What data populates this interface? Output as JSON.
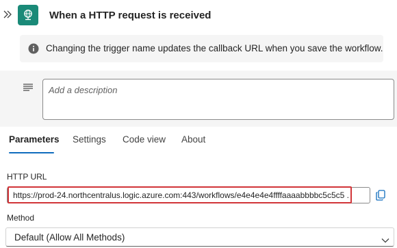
{
  "header": {
    "title": "When a HTTP request is received",
    "collapse_icon": "double-chevron-right-icon",
    "trigger_icon": "http-globe-icon",
    "accent_color": "#1a8a78"
  },
  "info_bar": {
    "text": "Changing the trigger name updates the callback URL when you save the workflow.",
    "icon": "info-icon"
  },
  "description": {
    "placeholder": "Add a description",
    "icon": "text-align-icon"
  },
  "tabs": [
    {
      "label": "Parameters",
      "active": true
    },
    {
      "label": "Settings",
      "active": false
    },
    {
      "label": "Code view",
      "active": false
    },
    {
      "label": "About",
      "active": false
    }
  ],
  "parameters": {
    "http_url": {
      "label": "HTTP URL",
      "value": "https://prod-24.northcentralus.logic.azure.com:443/workflows/e4e4e4e4ffffaaaabbbbc5c5c5 ...",
      "highlight_color": "#d13438",
      "copy_icon": "copy-icon"
    },
    "method": {
      "label": "Method",
      "value": "Default (Allow All Methods)",
      "icon": "chevron-down-icon"
    }
  }
}
